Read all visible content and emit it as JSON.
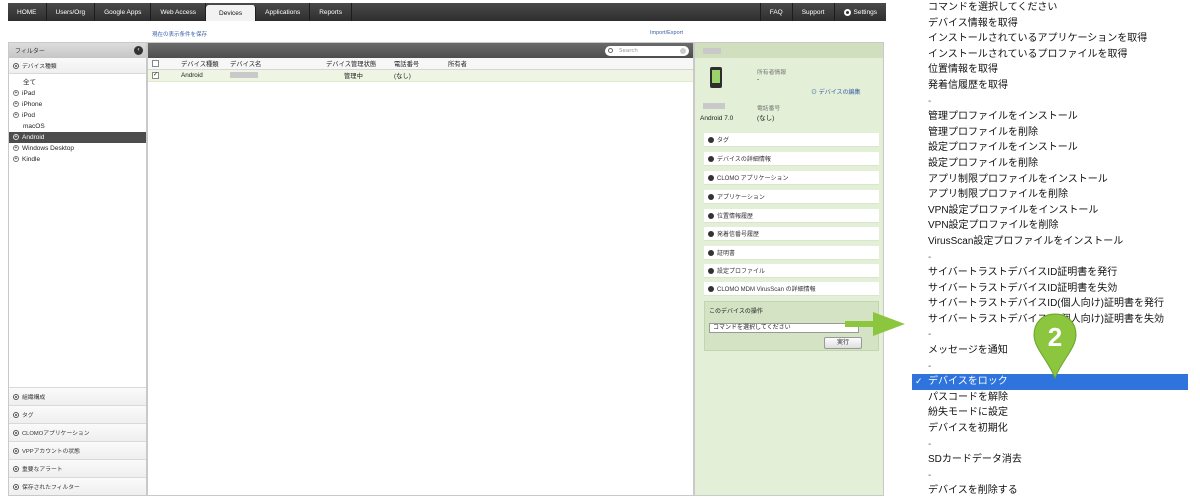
{
  "nav": {
    "items": [
      "HOME",
      "Users/Org",
      "Google Apps",
      "Web Access",
      "Devices",
      "Applications",
      "Reports"
    ],
    "active": "Devices",
    "right": [
      "FAQ",
      "Support",
      "Settings"
    ]
  },
  "links": {
    "save_filter": "現在の表示条件を保存",
    "import_export": "Import/Export"
  },
  "sidebar": {
    "header": "フィルター",
    "device_type_label": "デバイス種類",
    "devices": [
      "全て",
      "iPad",
      "iPhone",
      "iPod",
      "macOS",
      "Android",
      "Windows Desktop",
      "Kindle"
    ],
    "selected": "Android",
    "bottom_sections": [
      "組織構成",
      "タグ",
      "CLOMOアプリケーション",
      "VPPアカウントの状態",
      "重要なアラート",
      "保存されたフィルター"
    ]
  },
  "table": {
    "search_placeholder": "Search",
    "headers": [
      "デバイス種類",
      "デバイス名",
      "デバイス管理状態",
      "電話番号",
      "所有者"
    ],
    "rows": [
      {
        "type": "Android",
        "state": "管理中",
        "phone": "(なし)",
        "checked": "✓"
      }
    ]
  },
  "detail": {
    "os": "Android 7.0",
    "owner_label": "所有者情報",
    "owner_value": "-",
    "edit_link": "デバイスの編集",
    "phone_label": "電話番号",
    "phone_value": "(なし)",
    "sections": [
      "タグ",
      "デバイスの詳細情報",
      "CLOMO アプリケーション",
      "アプリケーション",
      "位置情報履歴",
      "発着信番号履歴",
      "証明書",
      "設定プロファイル",
      "CLOMO MDM VirusScan の詳細情報"
    ],
    "ops_title": "このデバイスの操作",
    "ops_select": "コマンドを選択してください",
    "ops_run": "実行"
  },
  "dropdown": {
    "items": [
      "コマンドを選択してください",
      "デバイス情報を取得",
      "インストールされているアプリケーションを取得",
      "インストールされているプロファイルを取得",
      "位置情報を取得",
      "発着信履歴を取得",
      "-",
      "管理プロファイルをインストール",
      "管理プロファイルを削除",
      "設定プロファイルをインストール",
      "設定プロファイルを削除",
      "アプリ制限プロファイルをインストール",
      "アプリ制限プロファイルを削除",
      "VPN設定プロファイルをインストール",
      "VPN設定プロファイルを削除",
      "VirusScan設定プロファイルをインストール",
      "-",
      "サイバートラストデバイスID証明書を発行",
      "サイバートラストデバイスID証明書を失効",
      "サイバートラストデバイスID(個人向け)証明書を発行",
      "サイバートラストデバイスID(個人向け)証明書を失効",
      "-",
      "メッセージを通知",
      "-",
      "デバイスをロック",
      "パスコードを解除",
      "紛失モードに設定",
      "デバイスを初期化",
      "-",
      "SDカードデータ消去",
      "-",
      "デバイスを削除する"
    ],
    "selected": "デバイスをロック"
  },
  "callout": {
    "number": "2"
  },
  "colors": {
    "accent_green": "#8cc63f",
    "highlight_blue": "#2f74dd",
    "nav_dark": "#3a3a3a"
  }
}
